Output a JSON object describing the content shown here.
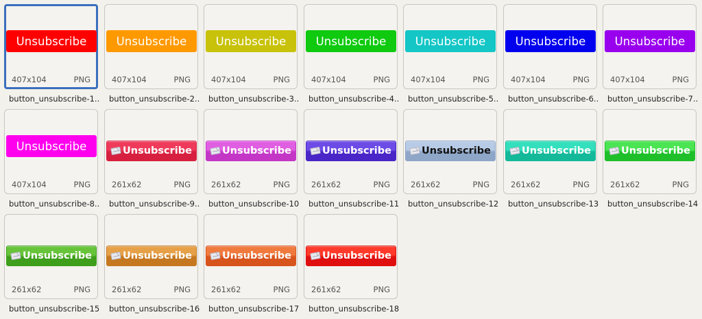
{
  "files": [
    {
      "name": "button_unsubscribe-1....",
      "size": "407x104",
      "type": "PNG",
      "label": "Unsubscribe",
      "style": "flat",
      "color": "#ff0000",
      "selected": true
    },
    {
      "name": "button_unsubscribe-2....",
      "size": "407x104",
      "type": "PNG",
      "label": "Unsubscribe",
      "style": "flat",
      "color": "#ff9900"
    },
    {
      "name": "button_unsubscribe-3....",
      "size": "407x104",
      "type": "PNG",
      "label": "Unsubscribe",
      "style": "flat",
      "color": "#c8c20a"
    },
    {
      "name": "button_unsubscribe-4....",
      "size": "407x104",
      "type": "PNG",
      "label": "Unsubscribe",
      "style": "flat",
      "color": "#0fca0f"
    },
    {
      "name": "button_unsubscribe-5....",
      "size": "407x104",
      "type": "PNG",
      "label": "Unsubscribe",
      "style": "flat",
      "color": "#14c6c6"
    },
    {
      "name": "button_unsubscribe-6....",
      "size": "407x104",
      "type": "PNG",
      "label": "Unsubscribe",
      "style": "flat",
      "color": "#0000ee"
    },
    {
      "name": "button_unsubscribe-7....",
      "size": "407x104",
      "type": "PNG",
      "label": "Unsubscribe",
      "style": "flat",
      "color": "#9900ee"
    },
    {
      "name": "button_unsubscribe-8....",
      "size": "407x104",
      "type": "PNG",
      "label": "Unsubscribe",
      "style": "flat",
      "color": "#ff00ee"
    },
    {
      "name": "button_unsubscribe-9....",
      "size": "261x62",
      "type": "PNG",
      "label": "Unsubscribe",
      "style": "gloss",
      "color": "#d7203f",
      "color2": "#ef3b5b"
    },
    {
      "name": "button_unsubscribe-10....",
      "size": "261x62",
      "type": "PNG",
      "label": "Unsubscribe",
      "style": "gloss",
      "color": "#c336c6",
      "color2": "#e05ee2"
    },
    {
      "name": "button_unsubscribe-11....",
      "size": "261x62",
      "type": "PNG",
      "label": "Unsubscribe",
      "style": "gloss",
      "color": "#4a25c7",
      "color2": "#6c4be6"
    },
    {
      "name": "button_unsubscribe-12....",
      "size": "261x62",
      "type": "PNG",
      "label": "Unsubscribe",
      "style": "gloss",
      "color": "#8ea6c8",
      "color2": "#b7cbe6",
      "textColor": "#111111"
    },
    {
      "name": "button_unsubscribe-13....",
      "size": "261x62",
      "type": "PNG",
      "label": "Unsubscribe",
      "style": "gloss",
      "color": "#14b99a",
      "color2": "#33dfbd"
    },
    {
      "name": "button_unsubscribe-14....",
      "size": "261x62",
      "type": "PNG",
      "label": "Unsubscribe",
      "style": "gloss",
      "color": "#1fbf2a",
      "color2": "#4be453"
    },
    {
      "name": "button_unsubscribe-15....",
      "size": "261x62",
      "type": "PNG",
      "label": "Unsubscribe",
      "style": "gloss",
      "color": "#3f9e1b",
      "color2": "#67c43a"
    },
    {
      "name": "button_unsubscribe-16....",
      "size": "261x62",
      "type": "PNG",
      "label": "Unsubscribe",
      "style": "gloss",
      "color": "#c57820",
      "color2": "#e6a048"
    },
    {
      "name": "button_unsubscribe-17....",
      "size": "261x62",
      "type": "PNG",
      "label": "Unsubscribe",
      "style": "gloss",
      "color": "#d8541d",
      "color2": "#f07a3e"
    },
    {
      "name": "button_unsubscribe-18....",
      "size": "261x62",
      "type": "PNG",
      "label": "Unsubscribe",
      "style": "gloss",
      "color": "#e01010",
      "color2": "#ff3a2a"
    }
  ]
}
